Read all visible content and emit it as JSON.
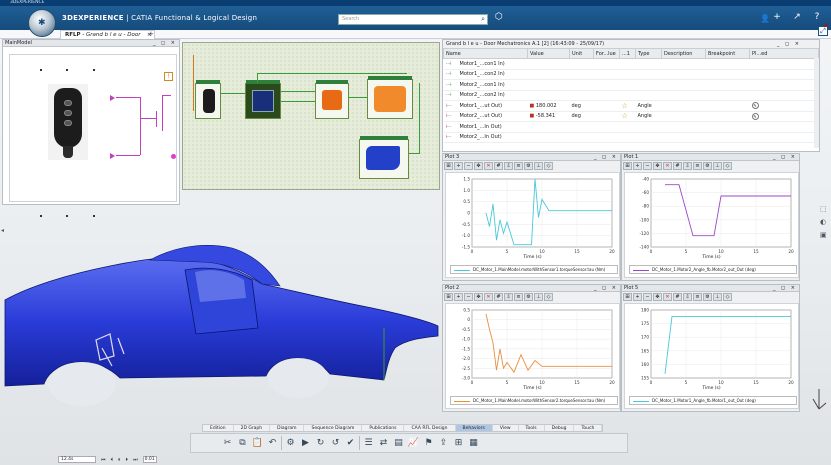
{
  "os": {
    "title": "3DEXPERIENCE"
  },
  "header": {
    "brand": "3DEXPERIENCE",
    "app": "CATIA Functional & Logical Design",
    "search_placeholder": "Search"
  },
  "tabs": [
    {
      "label": "RFLP",
      "title": "Grand b l e u - Door"
    }
  ],
  "main_model": {
    "title": "MainModel"
  },
  "table": {
    "title": "Grand b l e u - Door Mechatronics A.1 [2] (16:43:09 - 25/09/17)",
    "columns": [
      "Name",
      "Value",
      "Unit",
      "For...lue",
      "...1",
      "Type",
      "Description",
      "Breakpoint",
      "Pl...ed"
    ],
    "rows": [
      {
        "name": "Motor1_...con1 In)",
        "value": "",
        "unit": "",
        "type": ""
      },
      {
        "name": "Motor1_...con2 In)",
        "value": "",
        "unit": "",
        "type": ""
      },
      {
        "name": "Motor2_...con1 In)",
        "value": "",
        "unit": "",
        "type": ""
      },
      {
        "name": "Motor2_...con2 In)",
        "value": "",
        "unit": "",
        "type": ""
      },
      {
        "name": "Motor1_...ut Out)",
        "value": "180.002",
        "unit": "deg",
        "type": "Angle"
      },
      {
        "name": "Motor2_...ut Out)",
        "value": "-58.341",
        "unit": "deg",
        "type": "Angle"
      },
      {
        "name": "Motor1_...In Out)",
        "value": "",
        "unit": "",
        "type": ""
      },
      {
        "name": "Motor2_...In Out)",
        "value": "",
        "unit": "",
        "type": ""
      }
    ]
  },
  "plots": [
    {
      "title": "Plot 3",
      "xlabel": "Time (s)",
      "color": "#48c8d8",
      "legend": "DC_Motor_1.MainModel.motorWithSensor1.torqueSensor.tau (Nm)",
      "xlim": [
        0,
        20
      ],
      "ylim": [
        -1.5,
        1.5
      ],
      "yticks": [
        "1.5",
        "1.0",
        "0.5",
        "0",
        "-0.5",
        "-1.0",
        "-1.5"
      ],
      "xticks": [
        "0",
        "5",
        "10",
        "15",
        "20"
      ],
      "points": [
        [
          2,
          0
        ],
        [
          2.5,
          -0.6
        ],
        [
          3,
          0.4
        ],
        [
          3.5,
          -1.2
        ],
        [
          4,
          -0.3
        ],
        [
          4.5,
          -0.9
        ],
        [
          5,
          -0.4
        ],
        [
          6,
          -1.4
        ],
        [
          7,
          -1.4
        ],
        [
          8.5,
          -1.4
        ],
        [
          9,
          1.5
        ],
        [
          9.5,
          -0.2
        ],
        [
          10,
          0.6
        ],
        [
          11,
          0.1
        ],
        [
          20,
          0.1
        ]
      ]
    },
    {
      "title": "Plot 1",
      "xlabel": "Time (s)",
      "color": "#9a48c8",
      "legend": "DC_Motor_1.Motor2_Angle_fb.Motor2_out_Out (deg)",
      "xlim": [
        0,
        20
      ],
      "ylim": [
        -150,
        -30
      ],
      "yticks": [
        "-40",
        "-60",
        "-80",
        "-100",
        "-120",
        "-140"
      ],
      "xticks": [
        "0",
        "5",
        "10",
        "15",
        "20"
      ],
      "points": [
        [
          2,
          -40
        ],
        [
          4,
          -40
        ],
        [
          6,
          -130
        ],
        [
          9,
          -130
        ],
        [
          10,
          -60
        ],
        [
          20,
          -60
        ]
      ]
    },
    {
      "title": "Plot 2",
      "xlabel": "Time (s)",
      "color": "#e8903c",
      "legend": "DC_Motor_1.MainModel.motorWithSensor2.torqueSensor.tau (Nm)",
      "xlim": [
        0,
        20
      ],
      "ylim": [
        -3.0,
        0.5
      ],
      "yticks": [
        "0.5",
        "0",
        "-0.5",
        "-1.0",
        "-1.5",
        "-2.0",
        "-2.5",
        "-3.0"
      ],
      "xticks": [
        "0",
        "5",
        "10",
        "15",
        "20"
      ],
      "points": [
        [
          2,
          0.3
        ],
        [
          2.5,
          -0.5
        ],
        [
          3,
          -1.2
        ],
        [
          3.5,
          -2.6
        ],
        [
          4,
          -1.5
        ],
        [
          4.5,
          -2.5
        ],
        [
          5,
          -2.2
        ],
        [
          6,
          -2.7
        ],
        [
          7,
          -1.8
        ],
        [
          8,
          -2.6
        ],
        [
          9,
          -2.1
        ],
        [
          10,
          -2.4
        ],
        [
          11,
          -2.4
        ],
        [
          20,
          -2.4
        ]
      ]
    },
    {
      "title": "Plot 5",
      "xlabel": "Time (s)",
      "color": "#48c8d8",
      "legend": "DC_Motor_1.Motor1_Angle_fb.Motor1_out_Out (deg)",
      "xlim": [
        0,
        20
      ],
      "ylim": [
        150,
        182
      ],
      "yticks": [
        "180",
        "175",
        "170",
        "165",
        "160",
        "155"
      ],
      "xticks": [
        "0",
        "5",
        "10",
        "15",
        "20"
      ],
      "points": [
        [
          2,
          152
        ],
        [
          3,
          179
        ],
        [
          20,
          179
        ]
      ]
    }
  ],
  "action_tabs": [
    "Edition",
    "2D Graph",
    "Diagram",
    "Sequence Diagram",
    "Publications",
    "CAA RFL Design",
    "Behaviors",
    "View",
    "Tools",
    "Debug",
    "Touch"
  ],
  "active_tab": "Behaviors",
  "player": {
    "time": "12.4s",
    "speed": "0.01"
  },
  "colors": {
    "car": "#2a3cd8",
    "app_bar": "#1f5f96",
    "diagram_green": "#3a9b3a"
  }
}
